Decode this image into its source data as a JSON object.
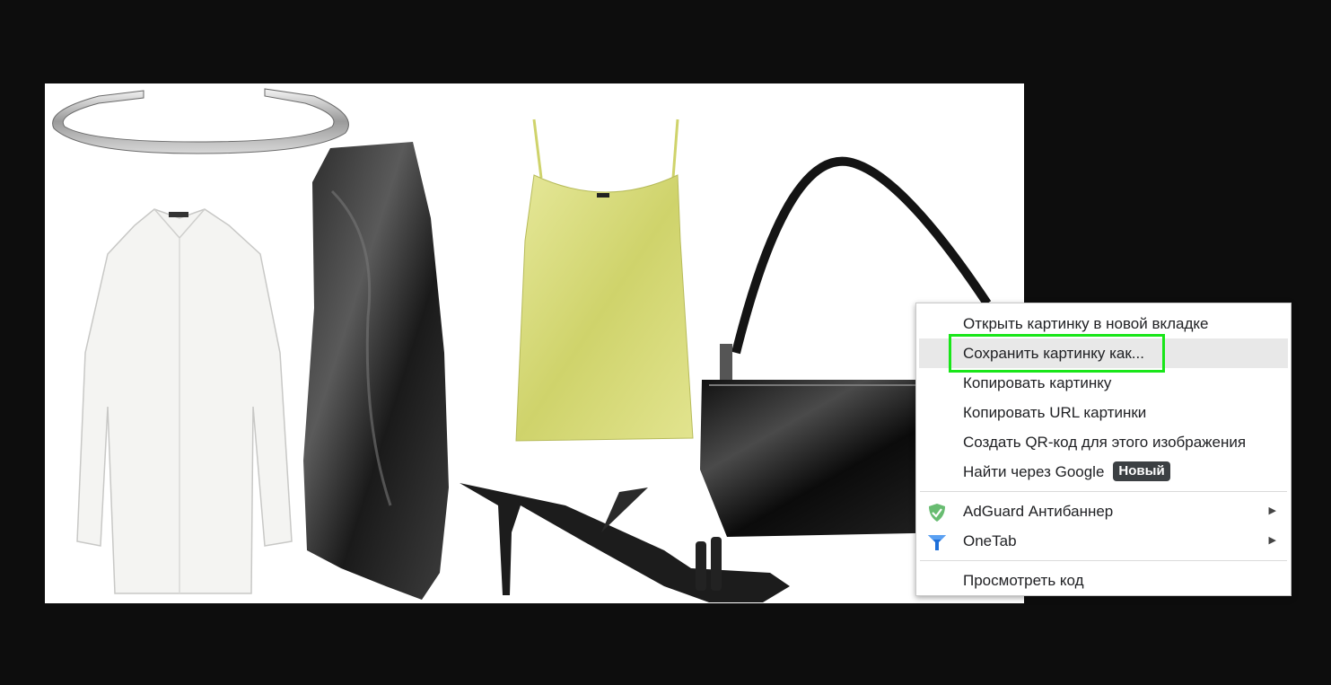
{
  "menu": {
    "items": [
      {
        "label": "Открыть картинку в новой вкладке"
      },
      {
        "label": "Сохранить картинку как..."
      },
      {
        "label": "Копировать картинку"
      },
      {
        "label": "Копировать URL картинки"
      },
      {
        "label": "Создать QR-код для этого изображения"
      },
      {
        "label": "Найти через Google",
        "badge": "Новый"
      }
    ],
    "extensions": [
      {
        "label": "AdGuard Антибаннер",
        "icon": "adguard-shield-icon"
      },
      {
        "label": "OneTab",
        "icon": "onetab-funnel-icon"
      }
    ],
    "inspect_label": "Просмотреть код",
    "submenu_arrow": "▶"
  },
  "colors": {
    "highlight": "#19e619",
    "hover_bg": "#e8e8e8",
    "badge_bg": "#3c4043",
    "adguard_green": "#68bc71",
    "onetab_blue": "#1e6fd9"
  }
}
